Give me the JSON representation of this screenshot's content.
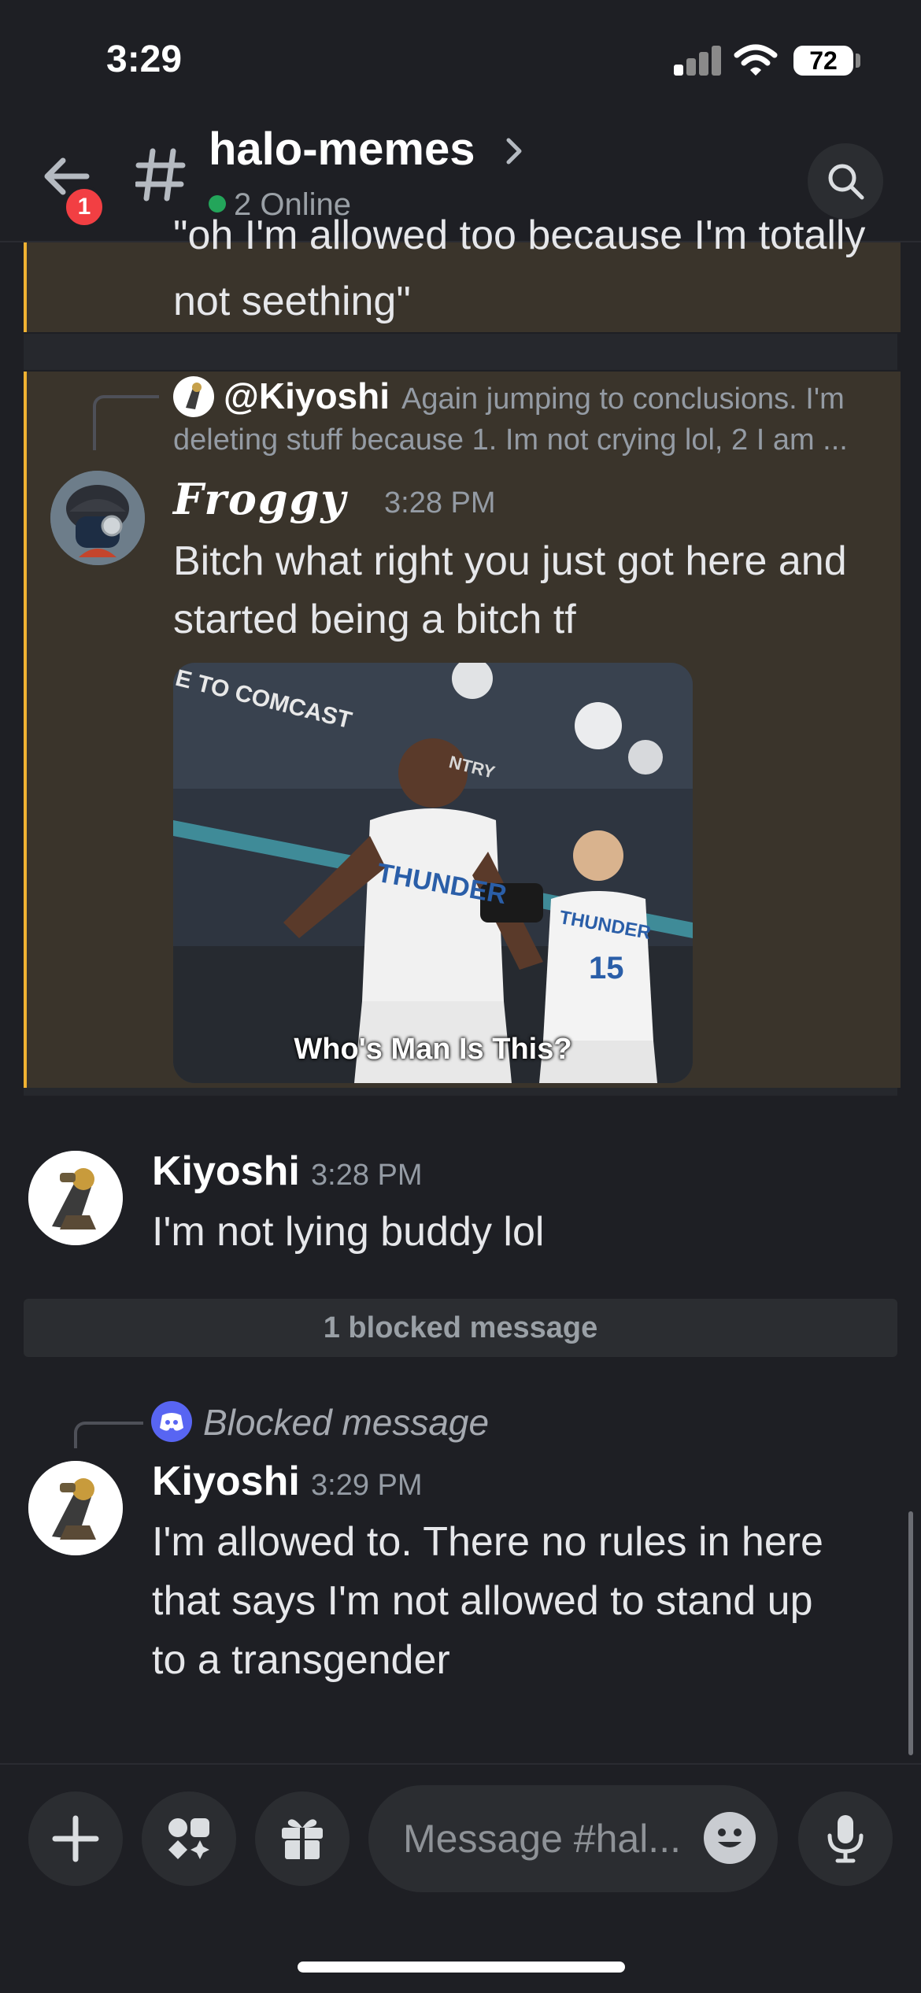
{
  "status_bar": {
    "time": "3:29",
    "battery": "72"
  },
  "header": {
    "channel_name": "halo-memes",
    "online": "2 Online",
    "unread_badge": "1"
  },
  "messages": [
    {
      "text_partial_top": "\"oh I'm allowed too because I'm totally",
      "text_partial_bottom": "not seething\""
    },
    {
      "reply_mention": "@Kiyoshi",
      "reply_preview_line1": "Again jumping to conclusions. I'm",
      "reply_preview_line2": "deleting stuff because 1. Im not crying lol, 2 I am ...",
      "author": "Froggy",
      "time": "3:28 PM",
      "text_line1": "Bitch what right you just got here and",
      "text_line2": "started being a bitch tf",
      "gif_caption": "Who's Man Is This?",
      "gif_banner": "E TO COMCAST",
      "gif_banner2": "NTRY",
      "jersey_left": "THUNDER",
      "jersey_right": "THUNDER",
      "jersey_number": "15"
    },
    {
      "author": "Kiyoshi",
      "time": "3:28 PM",
      "text": "I'm not lying buddy lol"
    },
    {
      "blocked_bar": "1 blocked message"
    },
    {
      "reply_label": "Blocked message",
      "author": "Kiyoshi",
      "time": "3:29 PM",
      "text_line1": "I'm allowed to. There no rules in here",
      "text_line2": "that says I'm not allowed to stand up",
      "text_line3": "to a transgender"
    }
  ],
  "composer": {
    "placeholder": "Message #hal..."
  },
  "colors": {
    "background": "#1e1f24",
    "highlight": "#3a342b",
    "highlight_border": "#f0b232",
    "online": "#23a55a",
    "badge": "#f23f43",
    "blurple": "#5865f2"
  },
  "icons": [
    "back-arrow-icon",
    "hashtag-icon",
    "chevron-right-icon",
    "search-icon",
    "plus-icon",
    "apps-icon",
    "gift-icon",
    "emoji-icon",
    "microphone-icon",
    "discord-logo-icon"
  ]
}
